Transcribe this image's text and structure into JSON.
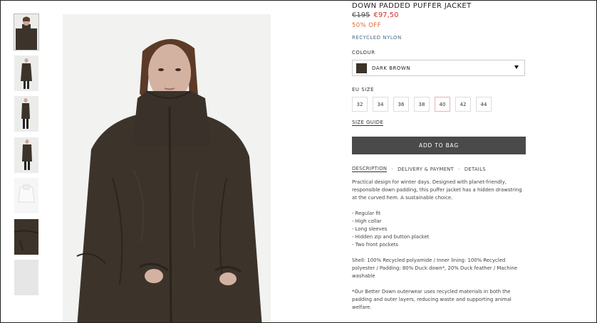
{
  "product": {
    "title": "DOWN PADDED PUFFER JACKET",
    "old_price": "€195",
    "new_price": "€97,50",
    "discount": "50% OFF",
    "material": "RECYCLED NYLON"
  },
  "colour": {
    "label": "COLOUR",
    "selected": "DARK BROWN",
    "swatch": "#3c342b"
  },
  "sizes": {
    "label": "EU SIZE",
    "options": [
      "32",
      "34",
      "36",
      "38",
      "40",
      "42",
      "44"
    ],
    "guide": "SIZE GUIDE"
  },
  "add_to_bag": "ADD TO BAG",
  "tabs": {
    "description": "DESCRIPTION",
    "delivery": "DELIVERY & PAYMENT",
    "details": "DETAILS",
    "separator": "-"
  },
  "description": {
    "intro": "Practical design for winter days.  Designed with planet-friendly, responsible down padding, this puffer jacket has a hidden drawstring at the curved hem. A sustainable choice.",
    "features": [
      "- Regular fit",
      "- High collar",
      "- Long sleeves",
      "- Hidden zip and button placket",
      "- Two front pockets"
    ],
    "composition": "Shell: 100% Recycled polyamide / Inner lining: 100% Recycled polyester / Padding: 80% Duck down*, 20% Duck feather / Machine washable",
    "note": "*Our Better Down outerwear uses recycled materials in both the padding and outer layers, reducing waste and supporting animal welfare."
  },
  "colors": {
    "accent_red": "#d0312d",
    "discount_orange": "#d66a3a",
    "material_blue": "#4a6b8a",
    "button": "#4a4a4a",
    "jacket": "#3c342b"
  }
}
